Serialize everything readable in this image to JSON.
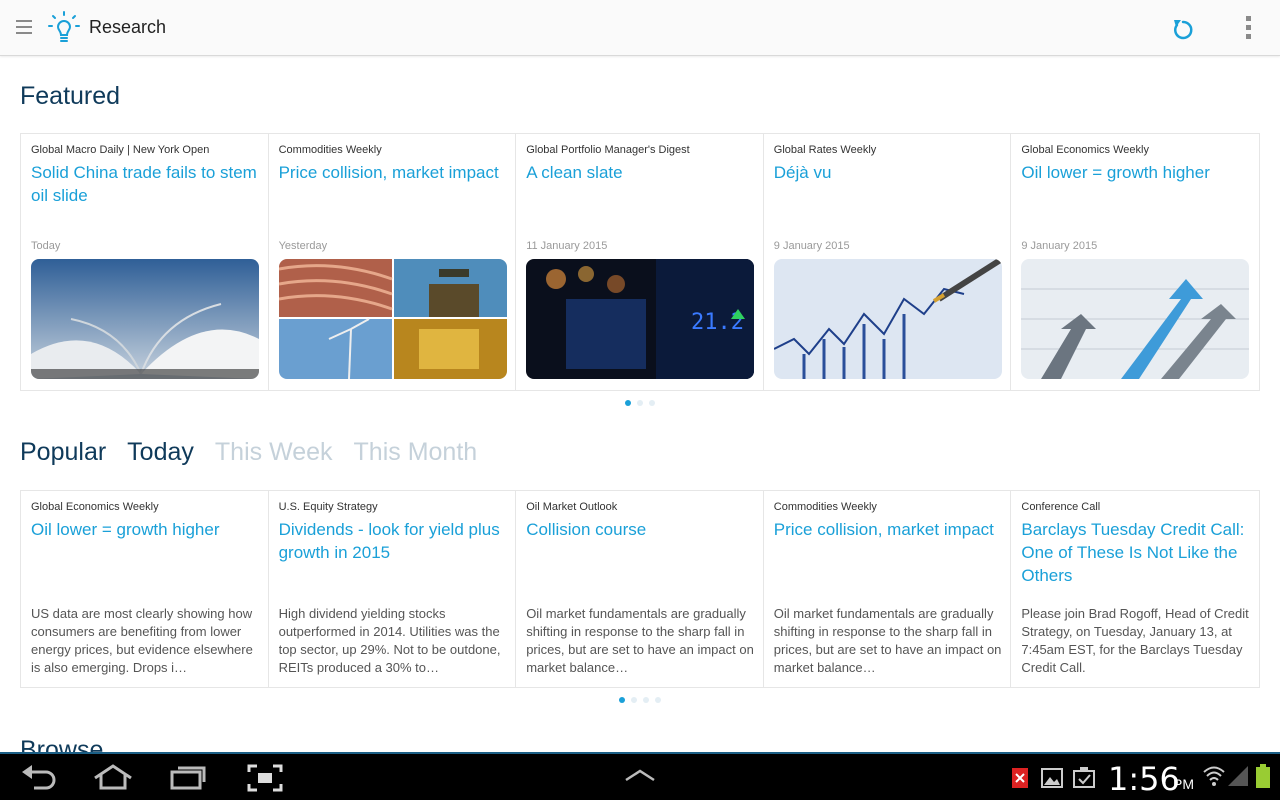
{
  "app": {
    "title": "Research"
  },
  "featured": {
    "heading": "Featured",
    "cards": [
      {
        "source": "Global Macro Daily | New York Open",
        "title": "Solid China trade fails to stem oil slide",
        "date": "Today",
        "image": "open-book"
      },
      {
        "source": "Commodities Weekly",
        "title": "Price collision, market impact",
        "date": "Yesterday",
        "image": "commodities-collage"
      },
      {
        "source": "Global Portfolio Manager's Digest",
        "title": "A clean slate",
        "date": "11 January 2015",
        "image": "stock-ticker-board"
      },
      {
        "source": "Global Rates Weekly",
        "title": "Déjà vu",
        "date": "9 January 2015",
        "image": "pen-on-chart"
      },
      {
        "source": "Global Economics Weekly",
        "title": "Oil lower = growth higher",
        "date": "9 January 2015",
        "image": "rising-arrows"
      }
    ]
  },
  "popular": {
    "heading": "Popular",
    "tabs": [
      {
        "label": "Today",
        "active": true
      },
      {
        "label": "This Week",
        "active": false
      },
      {
        "label": "This Month",
        "active": false
      }
    ],
    "cards": [
      {
        "source": "Global Economics Weekly",
        "title": "Oil lower = growth higher",
        "summary": "US data are most clearly showing how consumers are benefiting from lower energy prices, but evidence elsewhere is also emerging. Drops i…"
      },
      {
        "source": "U.S. Equity Strategy",
        "title": "Dividends - look for yield plus growth in 2015",
        "summary": "High dividend yielding stocks outperformed in 2014. Utilities was the top sector, up 29%. Not to be outdone, REITs produced a 30% to…"
      },
      {
        "source": "Oil Market Outlook",
        "title": "Collision course",
        "summary": "Oil market fundamentals are gradually shifting in response to the sharp fall in prices, but are set to have an impact on market balance…"
      },
      {
        "source": "Commodities Weekly",
        "title": "Price collision, market impact",
        "summary": "Oil market fundamentals are gradually shifting in response to the sharp fall in prices, but are set to have an impact on market balance…"
      },
      {
        "source": "Conference Call",
        "title": "Barclays Tuesday Credit Call: One of These Is Not Like the Others",
        "summary": "Please join Brad Rogoff, Head of Credit Strategy, on Tuesday, January 13, at 7:45am EST, for the Barclays Tuesday Credit Call."
      }
    ]
  },
  "browse": {
    "heading": "Browse"
  },
  "status_bar": {
    "time": "1:56",
    "ampm": "PM"
  },
  "colors": {
    "accent": "#1aa0d8",
    "heading": "#0f3a5a"
  }
}
